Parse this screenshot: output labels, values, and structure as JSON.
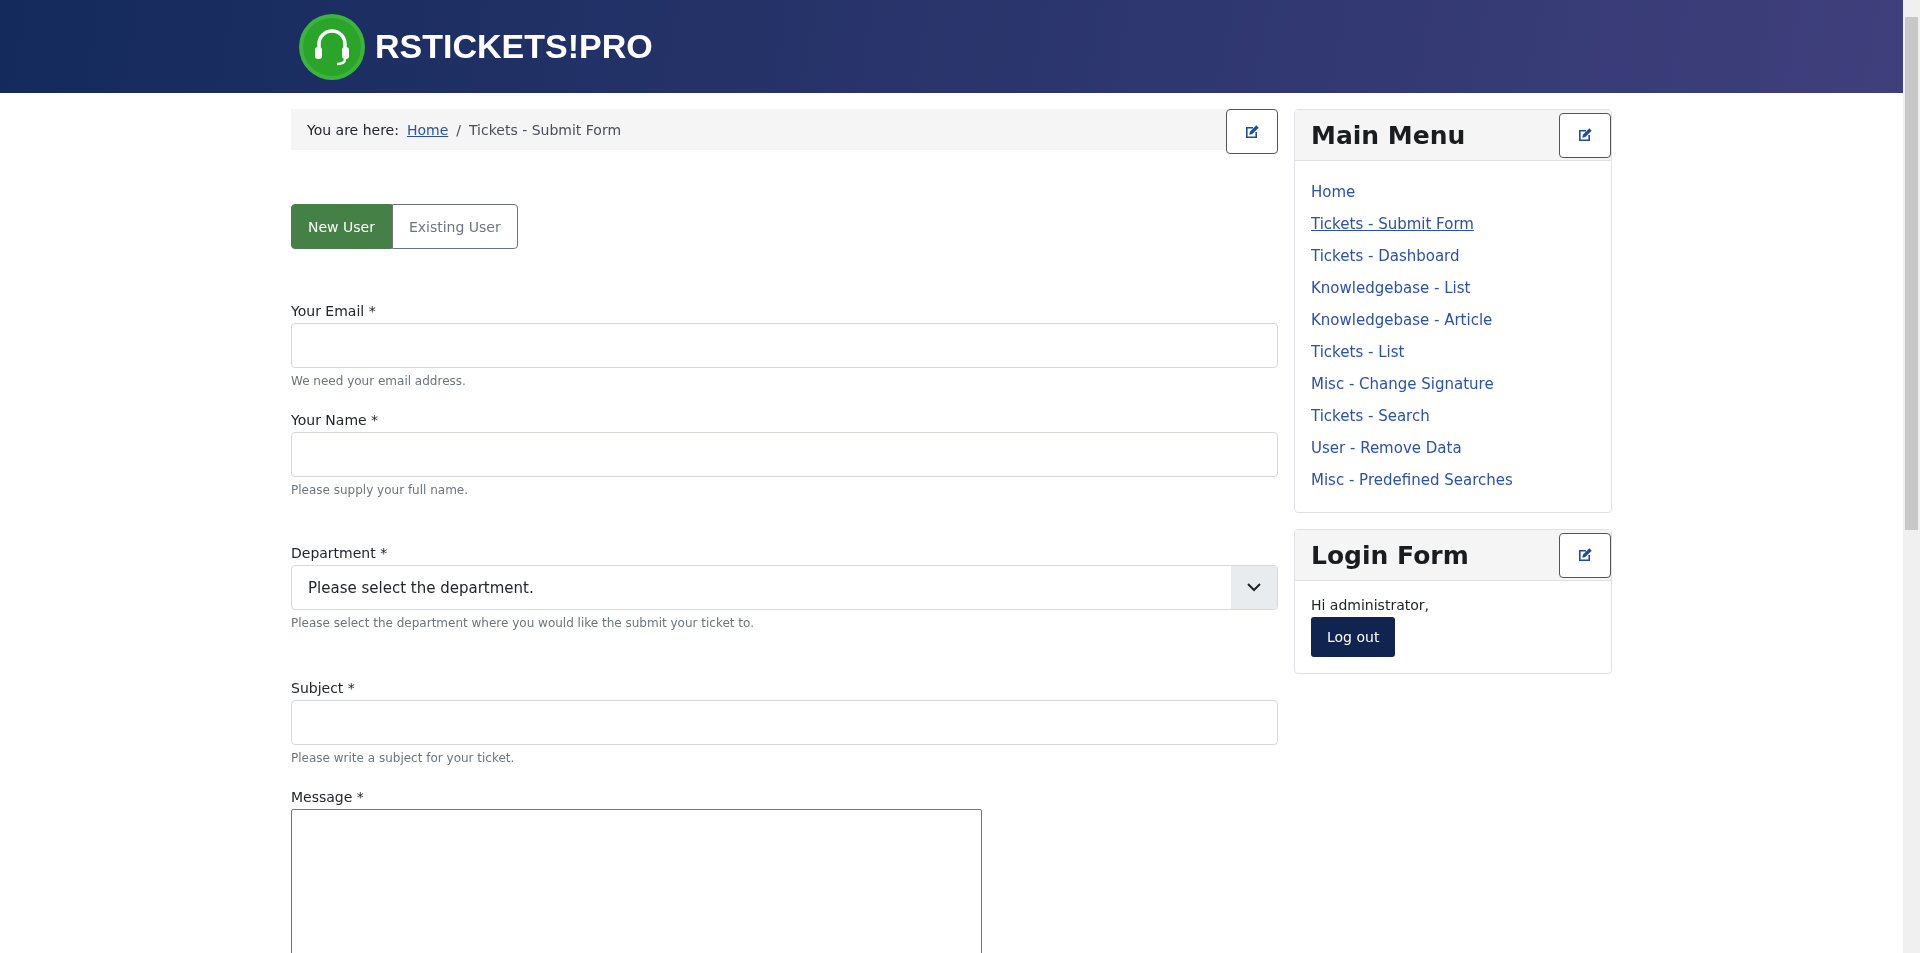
{
  "header": {
    "logo_text": "RSTICKETS!PRO"
  },
  "breadcrumb": {
    "prefix": "You are here:",
    "items": [
      {
        "label": "Home",
        "link": true
      },
      {
        "label": "Tickets - Submit Form",
        "link": false
      }
    ],
    "separator": "/"
  },
  "user_tabs": [
    {
      "label": "New User",
      "selected": true
    },
    {
      "label": "Existing User",
      "selected": false
    }
  ],
  "fields": [
    {
      "kind": "text",
      "label": "Your Email *",
      "hint": "We need your email address."
    },
    {
      "kind": "text",
      "label": "Your Name *",
      "hint": "Please supply your full name."
    },
    {
      "kind": "select",
      "label": "Department *",
      "value": "Please select the department.",
      "hint": "Please select the department where you would like the submit your ticket to."
    },
    {
      "kind": "text",
      "label": "Subject *",
      "hint": "Please write a subject for your ticket."
    },
    {
      "kind": "textarea",
      "label": "Message *"
    }
  ],
  "main_menu": {
    "title": "Main Menu",
    "items": [
      {
        "label": "Home",
        "selected": false
      },
      {
        "label": "Tickets - Submit Form",
        "selected": true
      },
      {
        "label": "Tickets - Dashboard",
        "selected": false
      },
      {
        "label": "Knowledgebase - List",
        "selected": false
      },
      {
        "label": "Knowledgebase - Article",
        "selected": false
      },
      {
        "label": "Tickets - List",
        "selected": false
      },
      {
        "label": "Misc - Change Signature",
        "selected": false
      },
      {
        "label": "Tickets - Search",
        "selected": false
      },
      {
        "label": "User - Remove Data",
        "selected": false
      },
      {
        "label": "Misc - Predefined Searches",
        "selected": false
      }
    ]
  },
  "login_form": {
    "title": "Login Form",
    "greeting": "Hi administrator,",
    "button": "Log out"
  }
}
